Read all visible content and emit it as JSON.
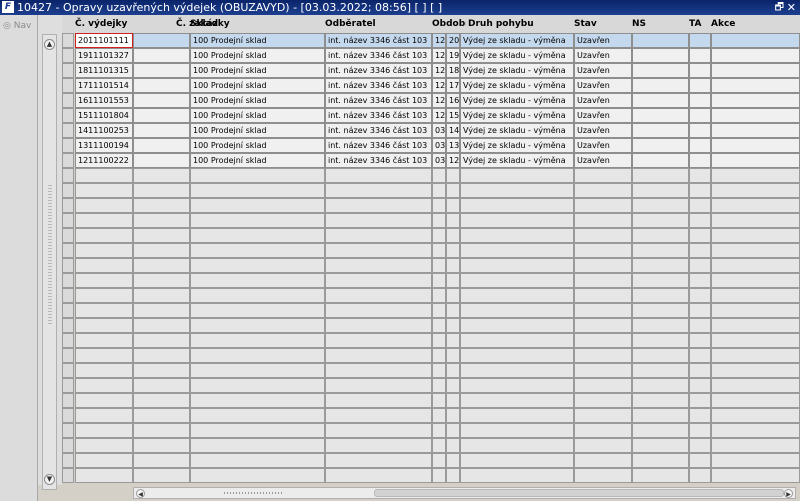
{
  "window": {
    "title": "10427 - Opravy uzavřených výdejek (OBUZAVYD) - [03.03.2022; 08:56]  [ ]  [ ]",
    "app_icon_label": "F",
    "restore_symbol": "🗗",
    "close_symbol": "✕"
  },
  "nav": {
    "label": "Nav"
  },
  "scroll": {
    "up": "▲",
    "down": "▼",
    "left": "◀",
    "right": "▶"
  },
  "columns": [
    {
      "key": "cislo",
      "label": "Č. výdejky"
    },
    {
      "key": "zakazka",
      "label": "Č. zakázky"
    },
    {
      "key": "sklad",
      "label": "Sklad"
    },
    {
      "key": "odberatel",
      "label": "Odběratel"
    },
    {
      "key": "obd1",
      "label": "Období"
    },
    {
      "key": "obd2",
      "label": ""
    },
    {
      "key": "druh",
      "label": "Druh pohybu"
    },
    {
      "key": "stav",
      "label": "Stav"
    },
    {
      "key": "ns",
      "label": "NS"
    },
    {
      "key": "ta",
      "label": "TA"
    },
    {
      "key": "akce",
      "label": "Akce"
    }
  ],
  "rows": [
    {
      "cislo": "2011101111",
      "zakazka": "",
      "sklad": "100 Prodejní sklad",
      "odberatel": "int. název 3346 část 103",
      "obd1": "12",
      "obd2": "20",
      "druh": "Výdej ze skladu - výměna",
      "stav": "Uzavřen",
      "ns": "",
      "ta": "",
      "akce": ""
    },
    {
      "cislo": "1911101327",
      "zakazka": "",
      "sklad": "100 Prodejní sklad",
      "odberatel": "int. název 3346 část 103",
      "obd1": "12",
      "obd2": "19",
      "druh": "Výdej ze skladu - výměna",
      "stav": "Uzavřen",
      "ns": "",
      "ta": "",
      "akce": ""
    },
    {
      "cislo": "1811101315",
      "zakazka": "",
      "sklad": "100 Prodejní sklad",
      "odberatel": "int. název 3346 část 103",
      "obd1": "12",
      "obd2": "18",
      "druh": "Výdej ze skladu - výměna",
      "stav": "Uzavřen",
      "ns": "",
      "ta": "",
      "akce": ""
    },
    {
      "cislo": "1711101514",
      "zakazka": "",
      "sklad": "100 Prodejní sklad",
      "odberatel": "int. název 3346 část 103",
      "obd1": "12",
      "obd2": "17",
      "druh": "Výdej ze skladu - výměna",
      "stav": "Uzavřen",
      "ns": "",
      "ta": "",
      "akce": ""
    },
    {
      "cislo": "1611101553",
      "zakazka": "",
      "sklad": "100 Prodejní sklad",
      "odberatel": "int. název 3346 část 103",
      "obd1": "12",
      "obd2": "16",
      "druh": "Výdej ze skladu - výměna",
      "stav": "Uzavřen",
      "ns": "",
      "ta": "",
      "akce": ""
    },
    {
      "cislo": "1511101804",
      "zakazka": "",
      "sklad": "100 Prodejní sklad",
      "odberatel": "int. název 3346 část 103",
      "obd1": "12",
      "obd2": "15",
      "druh": "Výdej ze skladu - výměna",
      "stav": "Uzavřen",
      "ns": "",
      "ta": "",
      "akce": ""
    },
    {
      "cislo": "1411100253",
      "zakazka": "",
      "sklad": "100 Prodejní sklad",
      "odberatel": "int. název 3346 část 103",
      "obd1": "03",
      "obd2": "14",
      "druh": "Výdej ze skladu - výměna",
      "stav": "Uzavřen",
      "ns": "",
      "ta": "",
      "akce": ""
    },
    {
      "cislo": "1311100194",
      "zakazka": "",
      "sklad": "100 Prodejní sklad",
      "odberatel": "int. název 3346 část 103",
      "obd1": "03",
      "obd2": "13",
      "druh": "Výdej ze skladu - výměna",
      "stav": "Uzavřen",
      "ns": "",
      "ta": "",
      "akce": ""
    },
    {
      "cislo": "1211100222",
      "zakazka": "",
      "sklad": "100 Prodejní sklad",
      "odberatel": "int. název 3346 část 103",
      "obd1": "03",
      "obd2": "12",
      "druh": "Výdej ze skladu - výměna",
      "stav": "Uzavřen",
      "ns": "",
      "ta": "",
      "akce": ""
    }
  ],
  "empty_row_count": 21
}
